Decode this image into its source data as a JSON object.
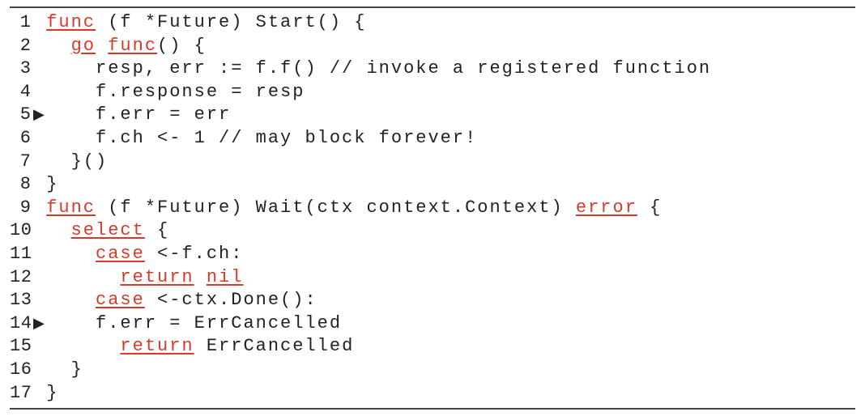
{
  "gutter": {
    "1": {
      "num": "1",
      "mark": " "
    },
    "2": {
      "num": "2",
      "mark": " "
    },
    "3": {
      "num": "3",
      "mark": " "
    },
    "4": {
      "num": "4",
      "mark": " "
    },
    "5": {
      "num": "5",
      "mark": "▶"
    },
    "6": {
      "num": "6",
      "mark": " "
    },
    "7": {
      "num": "7",
      "mark": " "
    },
    "8": {
      "num": "8",
      "mark": " "
    },
    "9": {
      "num": "9",
      "mark": " "
    },
    "10": {
      "num": "10",
      "mark": " "
    },
    "11": {
      "num": "11",
      "mark": " "
    },
    "12": {
      "num": "12",
      "mark": " "
    },
    "13": {
      "num": "13",
      "mark": " "
    },
    "14": {
      "num": "14",
      "mark": "▶"
    },
    "15": {
      "num": "15",
      "mark": " "
    },
    "16": {
      "num": "16",
      "mark": " "
    },
    "17": {
      "num": "17",
      "mark": " "
    }
  },
  "kw": {
    "func": "func",
    "go": "go",
    "select": "select",
    "case": "case",
    "return": "return",
    "nil": "nil",
    "error": "error"
  },
  "t": {
    "l1a": " (f *Future) Start() {",
    "l2a": "  ",
    "l2b": " ",
    "l2c": "() {",
    "l3": "    resp, err := f.f() // invoke a registered function",
    "l4": "    f.response = resp",
    "l5": "    f.err = err",
    "l6": "    f.ch <- 1 // may block forever!",
    "l7": "  }()",
    "l8": "}",
    "l9a": " (f *Future) Wait(ctx context.Context) ",
    "l9b": " {",
    "l10a": "  ",
    "l10b": " {",
    "l11a": "    ",
    "l11b": " <-f.ch:",
    "l12a": "      ",
    "l12b": " ",
    "l13a": "    ",
    "l13b": " <-ctx.Done():",
    "l14": "    f.err = ErrCancelled",
    "l15a": "      ",
    "l15b": " ErrCancelled",
    "l16": "  }",
    "l17": "}"
  }
}
